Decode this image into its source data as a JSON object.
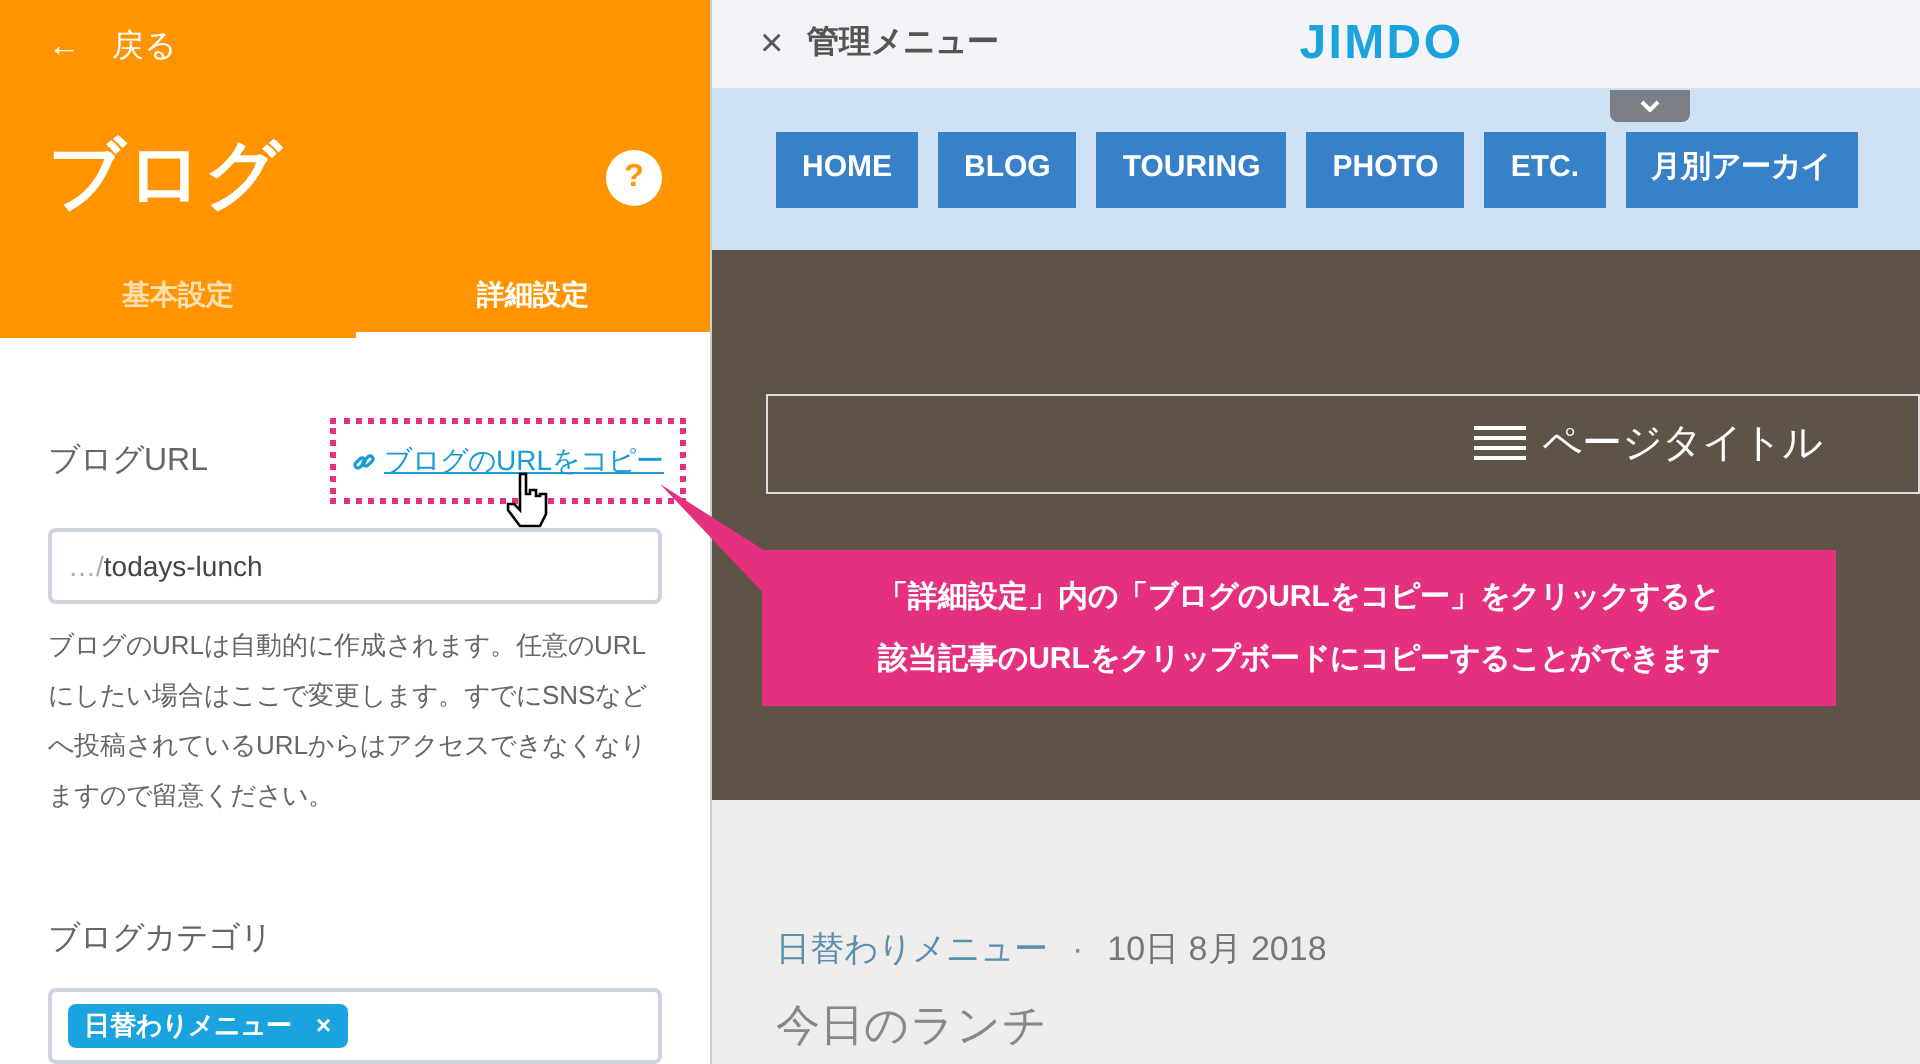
{
  "sidebar": {
    "back": {
      "icon": "←",
      "label": "戻る"
    },
    "title": "ブログ",
    "help": "?",
    "tabs": [
      {
        "label": "基本設定",
        "selected": false
      },
      {
        "label": "詳細設定",
        "selected": true
      }
    ],
    "url_field": {
      "label": "ブログURL",
      "copy_link": "ブログのURLをコピー",
      "prefix": "…/",
      "value": "todays-lunch",
      "help_text": "ブログのURLは自動的に作成されます。任意のURLにしたい場合はここで変更します。すでにSNSなどへ投稿されているURLからはアクセスできなくなりますので留意ください。"
    },
    "category_field": {
      "label": "ブログカテゴリ",
      "tags": [
        {
          "label": "日替わりメニュー",
          "remove": "×"
        }
      ]
    }
  },
  "admin_bar": {
    "close": "×",
    "title": "管理メニュー",
    "logo": "JIMDO"
  },
  "site_nav": [
    {
      "label": "HOME"
    },
    {
      "label": "BLOG"
    },
    {
      "label": "TOURING"
    },
    {
      "label": "PHOTO"
    },
    {
      "label": "ETC."
    },
    {
      "label": "月別アーカイ"
    }
  ],
  "hero": {
    "page_title": "ページタイトル"
  },
  "post": {
    "category": "日替わりメニュー",
    "separator": "·",
    "date": "10日 8月 2018",
    "title": "今日のランチ"
  },
  "callout": {
    "lines": [
      "「詳細設定」内の「ブログのURLをコピー」をクリックすると",
      "該当記事のURLをクリップボードにコピーすることができます"
    ]
  }
}
